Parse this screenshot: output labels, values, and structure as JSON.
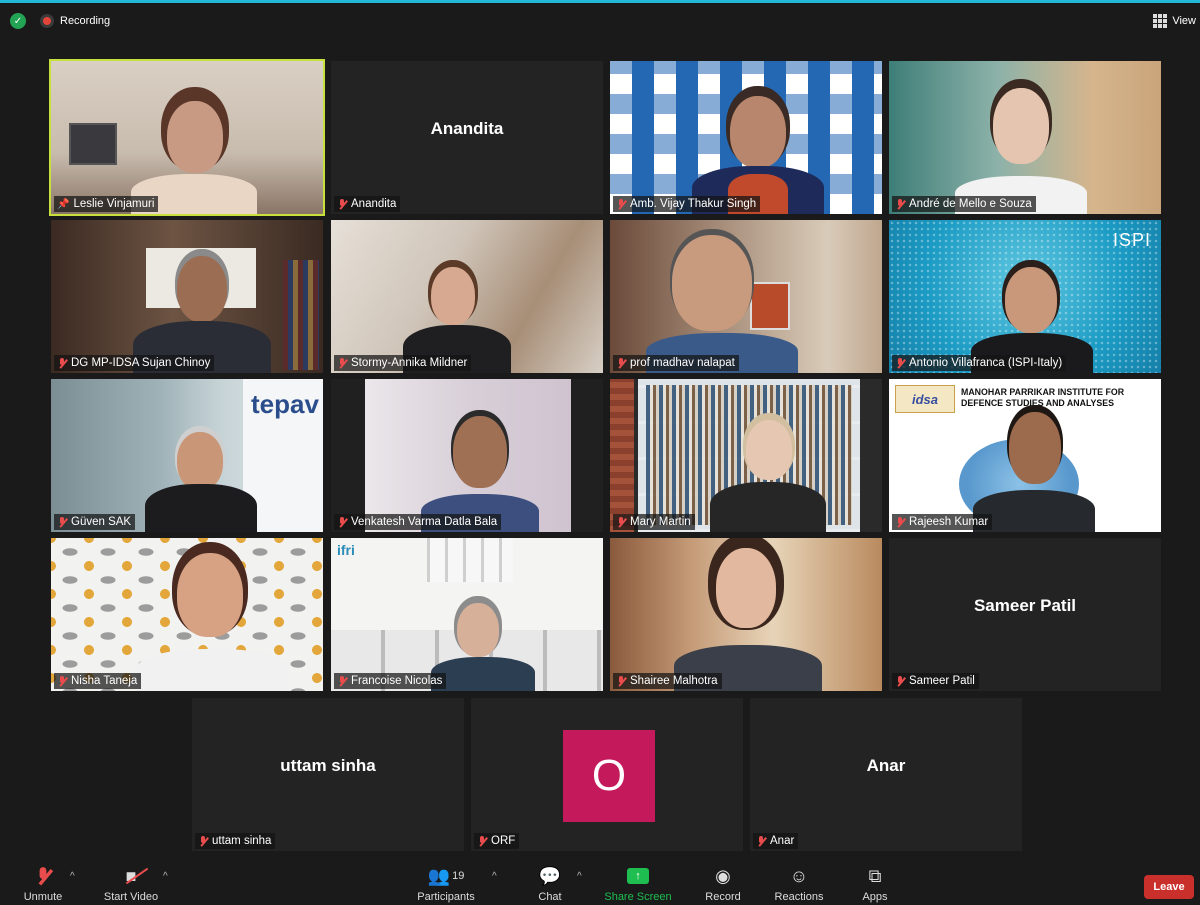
{
  "topbar": {
    "recording_label": "Recording",
    "view_label": "View"
  },
  "tiles": [
    {
      "name": "Leslie Vinjamuri",
      "active": true,
      "pinned": true
    },
    {
      "name": "Anandita",
      "video": false
    },
    {
      "name": "Amb. Vijay Thakur Singh"
    },
    {
      "name": "André de Mello e Souza"
    },
    {
      "name": "DG MP-IDSA Sujan Chinoy"
    },
    {
      "name": "Stormy-Annika Mildner"
    },
    {
      "name": "prof madhav nalapat"
    },
    {
      "name": "Antonio Villafranca (ISPI-Italy)"
    },
    {
      "name": "Güven SAK"
    },
    {
      "name": "Venkatesh Varma Datla Bala"
    },
    {
      "name": "Mary Martin"
    },
    {
      "name": "Rajeesh Kumar"
    },
    {
      "name": "Nisha Taneja"
    },
    {
      "name": "Francoise Nicolas"
    },
    {
      "name": "Shairee Malhotra"
    },
    {
      "name": "Sameer Patil",
      "video": false
    },
    {
      "name": "uttam sinha",
      "video": false
    },
    {
      "name": "ORF",
      "video": false,
      "avatar_letter": "O"
    },
    {
      "name": "Anar",
      "video": false
    }
  ],
  "backgrounds": {
    "ispi_text": "ISPI",
    "tepav_text": "tepav",
    "idsa_title": "MANOHAR PARRIKAR INSTITUTE FOR DEFENCE STUDIES AND ANALYSES",
    "ifri_text": "ifri"
  },
  "toolbar": {
    "unmute": "Unmute",
    "start_video": "Start Video",
    "participants": "Participants",
    "participants_count": "19",
    "chat": "Chat",
    "share_screen": "Share Screen",
    "record": "Record",
    "reactions": "Reactions",
    "apps": "Apps",
    "leave": "Leave"
  },
  "colors": {
    "accent_top": "#23b7d9",
    "active_speaker": "#c7e03b",
    "share_green": "#1fbe50",
    "leave_red": "#c9302c",
    "avatar_bg": "#c4195b",
    "mute_red": "#e84c4c"
  }
}
